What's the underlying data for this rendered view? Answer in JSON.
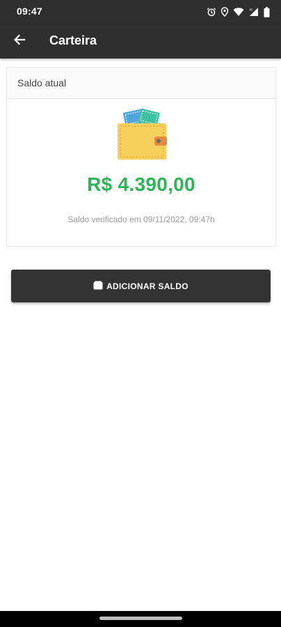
{
  "status_bar": {
    "time": "09:47",
    "icons": [
      "alarm-icon",
      "location-icon",
      "wifi-icon",
      "signal-icon",
      "battery-icon"
    ]
  },
  "app_bar": {
    "title": "Carteira",
    "back_icon": "arrow-left-icon"
  },
  "card": {
    "header": "Saldo atual",
    "icon": "wallet-icon",
    "balance": "R$ 4.390,00",
    "verified_text": "Saldo verificado em 09/11/2022, 09:47h"
  },
  "actions": {
    "add_balance_label": "ADICIONAR SALDO",
    "add_balance_icon": "wallet-small-icon"
  },
  "colors": {
    "app_bar": "#2f2f2f",
    "balance_green": "#2db559",
    "button_dark": "#333333",
    "wallet_yellow": "#f7cf5c"
  }
}
